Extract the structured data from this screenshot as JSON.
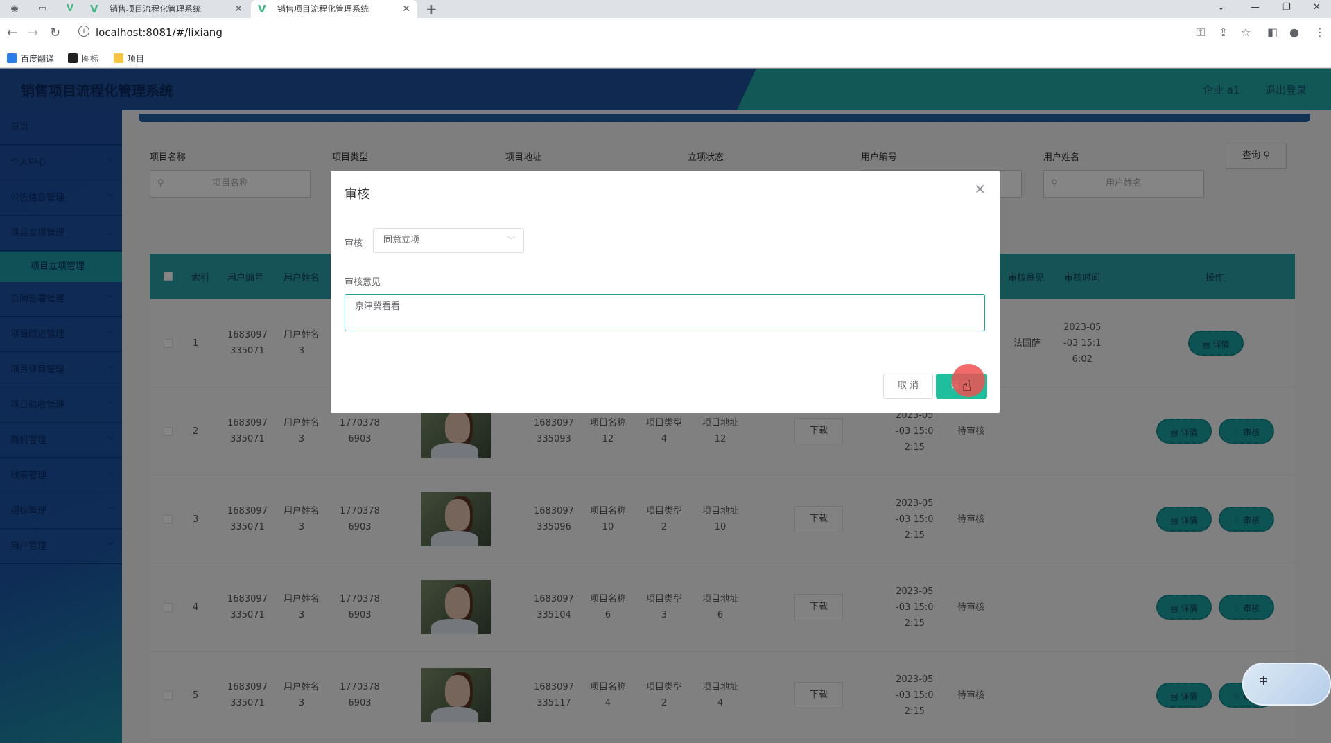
{
  "browser": {
    "tabs": [
      {
        "title": ""
      },
      {
        "title": "销售项目流程化管理系统"
      },
      {
        "title": "销售项目流程化管理系统"
      }
    ],
    "url": "localhost:8081/#/lixiang",
    "bookmarks": [
      "百度翻译",
      "图标",
      "项目"
    ]
  },
  "header": {
    "title": "销售项目流程化管理系统",
    "user": "企业 a1",
    "logout": "退出登录"
  },
  "sidebar": {
    "items": [
      {
        "label": "首页"
      },
      {
        "label": "个人中心"
      },
      {
        "label": "公告信息管理"
      },
      {
        "label": "项目立项管理"
      },
      {
        "label": "项目立项管理",
        "sub": true
      },
      {
        "label": "合同签署管理"
      },
      {
        "label": "项目跟进管理"
      },
      {
        "label": "项目评审管理"
      },
      {
        "label": "项目验收管理"
      },
      {
        "label": "商机管理"
      },
      {
        "label": "线索管理"
      },
      {
        "label": "招标管理"
      },
      {
        "label": "用户管理"
      }
    ]
  },
  "filters": {
    "labels": [
      "项目名称",
      "项目类型",
      "项目地址",
      "立项状态",
      "用户编号",
      "用户姓名"
    ],
    "placeholders": [
      "项目名称",
      "用户姓名"
    ],
    "query_button": "查询"
  },
  "table": {
    "headers": [
      "索引",
      "用户编号",
      "用户姓名",
      "审核意见",
      "审核时间",
      "操作"
    ],
    "download_label": "下载",
    "detail_label": "详情",
    "review_label": "审核",
    "rows": [
      {
        "index": "1",
        "user_no": [
          "1683097",
          "335071"
        ],
        "user_name": [
          "用户姓名",
          "3"
        ],
        "opinion": "法国萨",
        "time": [
          "2023-05",
          "-03 15:1",
          "6:02"
        ]
      },
      {
        "index": "2",
        "user_no": [
          "1683097",
          "335071"
        ],
        "user_name": [
          "用户姓名",
          "3"
        ],
        "phone": [
          "1770378",
          "6903"
        ],
        "project_no": [
          "1683097",
          "335093"
        ],
        "project_name": [
          "项目名称",
          "12"
        ],
        "project_type": [
          "项目类型",
          "4"
        ],
        "project_addr": [
          "项目地址",
          "12"
        ],
        "time": [
          "2023-05",
          "-03 15:0",
          "2:15"
        ],
        "status": "待审核"
      },
      {
        "index": "3",
        "user_no": [
          "1683097",
          "335071"
        ],
        "user_name": [
          "用户姓名",
          "3"
        ],
        "phone": [
          "1770378",
          "6903"
        ],
        "project_no": [
          "1683097",
          "335096"
        ],
        "project_name": [
          "项目名称",
          "10"
        ],
        "project_type": [
          "项目类型",
          "2"
        ],
        "project_addr": [
          "项目地址",
          "10"
        ],
        "time": [
          "2023-05",
          "-03 15:0",
          "2:15"
        ],
        "status": "待审核"
      },
      {
        "index": "4",
        "user_no": [
          "1683097",
          "335071"
        ],
        "user_name": [
          "用户姓名",
          "3"
        ],
        "phone": [
          "1770378",
          "6903"
        ],
        "project_no": [
          "1683097",
          "335104"
        ],
        "project_name": [
          "项目名称",
          "6"
        ],
        "project_type": [
          "项目类型",
          "3"
        ],
        "project_addr": [
          "项目地址",
          "6"
        ],
        "time": [
          "2023-05",
          "-03 15:0",
          "2:15"
        ],
        "status": "待审核"
      },
      {
        "index": "5",
        "user_no": [
          "1683097",
          "335071"
        ],
        "user_name": [
          "用户姓名",
          "3"
        ],
        "phone": [
          "1770378",
          "6903"
        ],
        "project_no": [
          "1683097",
          "335117"
        ],
        "project_name": [
          "项目名称",
          "4"
        ],
        "project_type": [
          "项目类型",
          "2"
        ],
        "project_addr": [
          "项目地址",
          "4"
        ],
        "time": [
          "2023-05",
          "-03 15:0",
          "2:15"
        ],
        "status": "待审核"
      }
    ]
  },
  "dialog": {
    "title": "审核",
    "review_label": "审核",
    "review_value": "同意立项",
    "opinion_label": "审核意见",
    "opinion_value": "京津冀看看",
    "cancel": "取 消",
    "confirm": "确 定"
  },
  "ime": {
    "label": "中"
  },
  "colors": {
    "header": "#1e4f9a",
    "accent": "#22a9a6",
    "confirm": "#1fbf9e"
  }
}
